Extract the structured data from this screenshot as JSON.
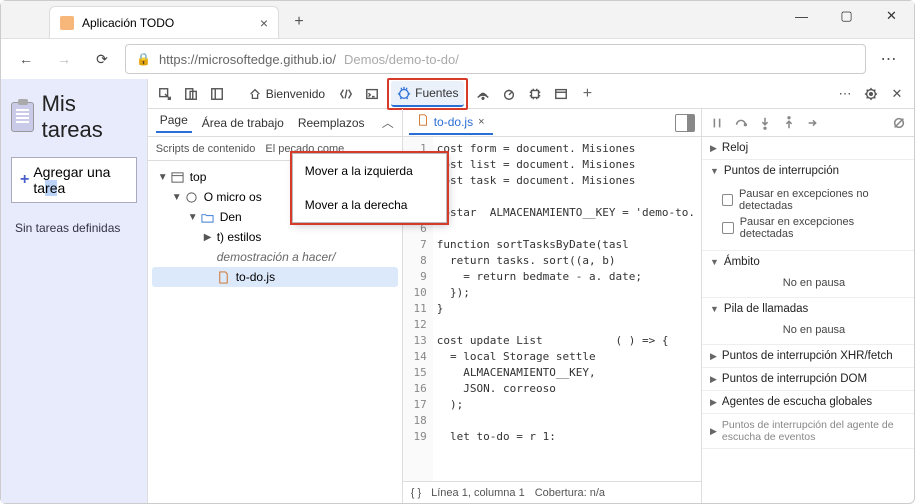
{
  "window": {
    "tab_title": "Aplicación TODO",
    "url_host": "https://microsoftedge.github.io/",
    "url_path": "Demos/demo-to-do/"
  },
  "app": {
    "title": "Mis tareas",
    "add_prefix": "Agregar una ta",
    "add_sel": "re",
    "add_suffix": "a",
    "empty": "Sin tareas definidas"
  },
  "devtools": {
    "welcome": "Bienvenido",
    "sources": "Fuentes",
    "nav_tabs": {
      "page": "Page",
      "workspace": "Área de trabajo",
      "overrides": "Reemplazos"
    },
    "nav_sub": {
      "content_scripts": "Scripts de contenido",
      "sin": "El pecado come"
    },
    "tree": {
      "top": "top",
      "origin": "O micro os",
      "demos": "Den",
      "styles": "t) estilos",
      "todo_dir": "demostración a hacer/",
      "todo_js": "to-do.js"
    },
    "context_menu": {
      "left": "Mover a la izquierda",
      "right": "Mover a la derecha"
    },
    "editor": {
      "file": "to-do.js",
      "lines": [
        "cost form = document. Misiones",
        "cost list = document. Misiones",
        "cost task = document. Misiones",
        "",
        "costar  ALMACENAMIENTO__KEY = 'demo-to.",
        "",
        "function sortTasksByDate(tasl",
        "  return tasks. sort((a, b)",
        "    = return bedmate - a. date;",
        "  });",
        "}",
        "",
        "cost update List           ( ) => {",
        "  = local Storage settle",
        "    ALMACENAMIENTO__KEY,",
        "    JSON. correoso",
        "  );",
        "",
        "  let to-do = r 1:"
      ],
      "status_left": "{ }",
      "status_pos": "Línea 1, columna 1",
      "status_cov": "Cobertura: n/a"
    },
    "debugger": {
      "watch": "Reloj",
      "breakpoints": "Puntos de interrupción",
      "pause_uncaught": "Pausar en excepciones no detectadas",
      "pause_caught": "Pausar en excepciones detectadas",
      "scope": "Ámbito",
      "not_paused": "No en pausa",
      "callstack": "Pila de llamadas",
      "xhr": "Puntos de interrupción XHR/fetch",
      "dom": "Puntos de interrupción DOM",
      "listeners": "Agentes de escucha globales",
      "event_bp": "Puntos de interrupción del agente de escucha de eventos"
    }
  }
}
